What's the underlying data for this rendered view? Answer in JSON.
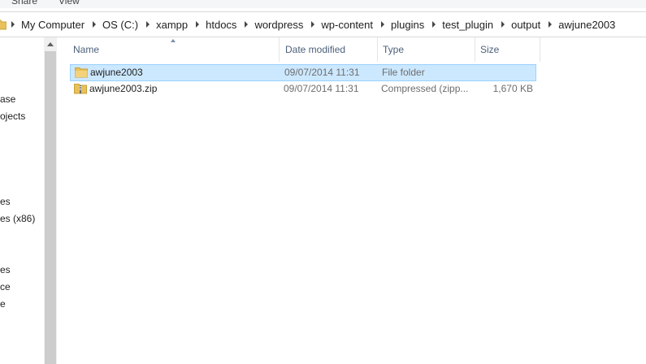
{
  "ribbon": {
    "tabs": [
      "Share",
      "View"
    ]
  },
  "address_bar": {
    "crumbs": [
      "My Computer",
      "OS (C:)",
      "xampp",
      "htdocs",
      "wordpress",
      "wp-content",
      "plugins",
      "test_plugin",
      "output",
      "awjune2003"
    ]
  },
  "nav_pane": {
    "items": [
      "ase",
      "ojects",
      "es",
      "es (x86)",
      "es",
      "ce",
      "e"
    ]
  },
  "columns": {
    "name": "Name",
    "date": "Date modified",
    "type": "Type",
    "size": "Size"
  },
  "files": [
    {
      "name": "awjune2003",
      "date": "09/07/2014 11:31",
      "type": "File folder",
      "size": "",
      "icon": "folder-icon",
      "selected": true
    },
    {
      "name": "awjune2003.zip",
      "date": "09/07/2014 11:31",
      "type": "Compressed (zipp...",
      "size": "1,670 KB",
      "icon": "zip-folder-icon",
      "selected": false
    }
  ],
  "colors": {
    "selection_bg": "#cce8ff",
    "selection_border": "#99d1ff",
    "header_text": "#4c607a",
    "folder_yellow": "#e8c15a"
  }
}
